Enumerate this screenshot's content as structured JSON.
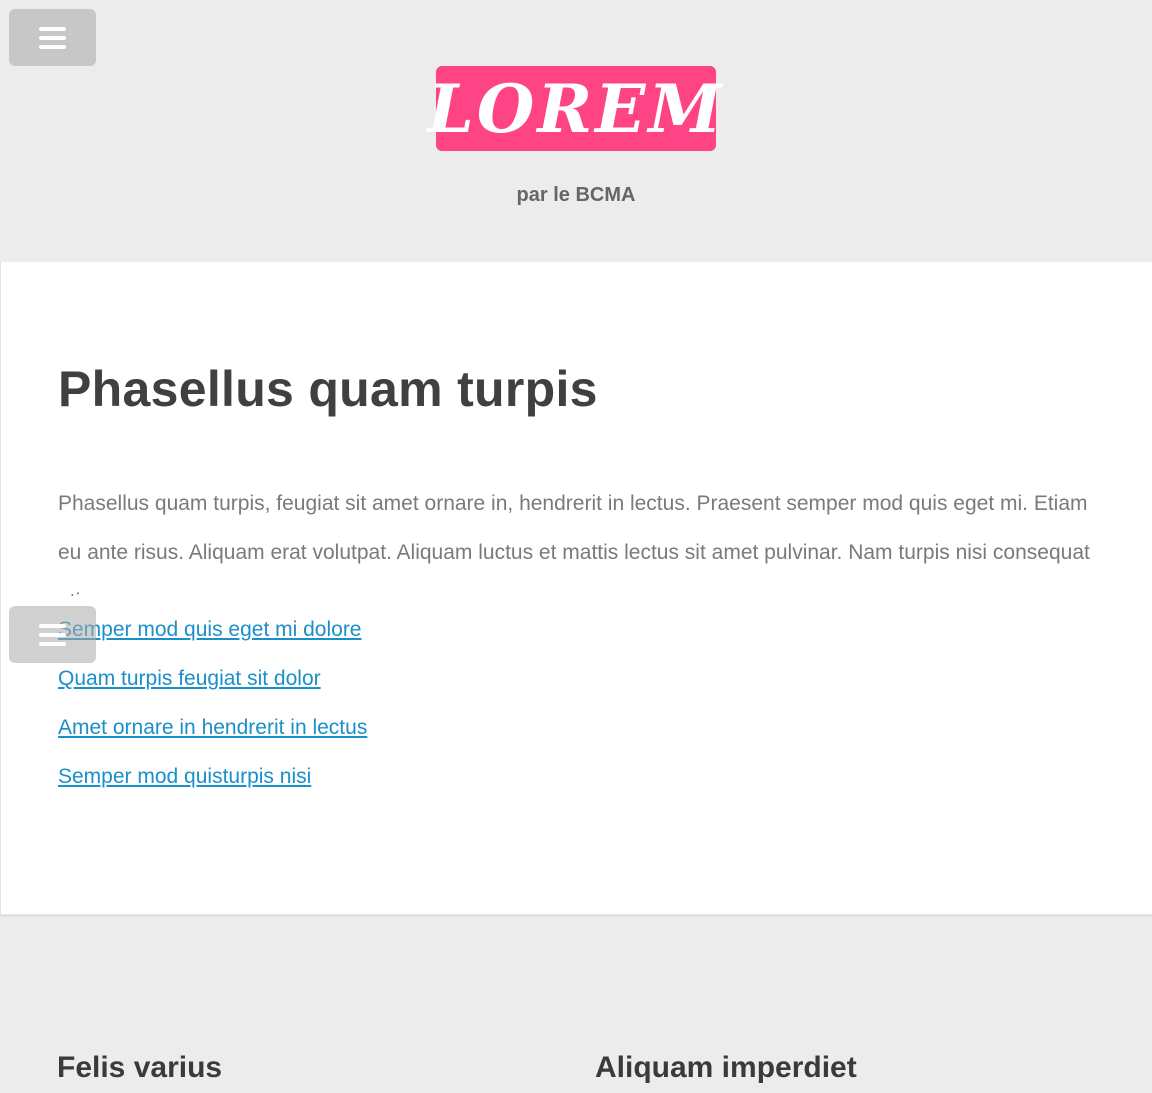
{
  "header": {
    "logo_text": "LOREM",
    "tagline": "par le BCMA",
    "menu_icon": "hamburger-menu-icon"
  },
  "main": {
    "title": "Phasellus quam turpis",
    "intro": "Phasellus quam turpis, feugiat sit amet ornare in, hendrerit in lectus. Praesent semper mod quis eget mi. Etiam eu ante risus. Aliquam erat volutpat. Aliquam luctus et mattis lectus sit amet pulvinar. Nam turpis nisi consequat etiam",
    "links": [
      "Semper mod quis eget mi dolore",
      "Quam turpis feugiat sit dolor",
      "Amet ornare in hendrerit in lectus",
      "Semper mod quisturpis nisi"
    ]
  },
  "footer": {
    "col1_title": "Felis varius",
    "col2_title": "Aliquam imperdiet"
  },
  "colors": {
    "accent": "#ff4486",
    "link": "#1a8fc9",
    "background": "#ececec"
  }
}
